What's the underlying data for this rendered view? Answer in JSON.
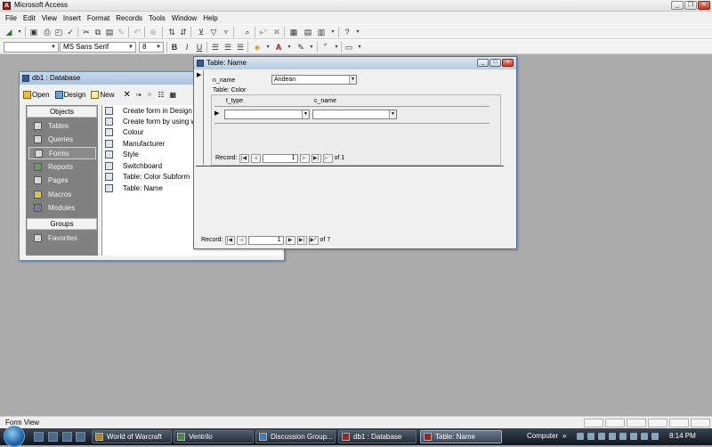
{
  "app": {
    "title": "Microsoft Access"
  },
  "menu": [
    "File",
    "Edit",
    "View",
    "Insert",
    "Format",
    "Records",
    "Tools",
    "Window",
    "Help"
  ],
  "format_toolbar": {
    "font": "MS Sans Serif",
    "size": "8",
    "bold": "B",
    "italic": "I",
    "underline": "U"
  },
  "db_window": {
    "title": "db1 : Database",
    "toolbar": {
      "open": "Open",
      "design": "Design",
      "new": "New"
    },
    "objects_header": "Objects",
    "objects": [
      "Tables",
      "Queries",
      "Forms",
      "Reports",
      "Pages",
      "Macros",
      "Modules"
    ],
    "selected_object": "Forms",
    "groups_header": "Groups",
    "groups": [
      "Favorites"
    ],
    "list": [
      "Create form in Design view",
      "Create form by using wizard",
      "Colour",
      "Manufacturer",
      "Style",
      "Switchboard",
      "Table: Color Subform",
      "Table: Name"
    ]
  },
  "form_window": {
    "title": "Table: Name",
    "field_label": "n_name",
    "field_value": "Andean",
    "subform_label": "Table: Color",
    "subform_columns": [
      "t_type",
      "c_name"
    ],
    "subform_nav": {
      "record_label": "Record:",
      "current": "1",
      "of_label": "of",
      "total": "1"
    },
    "main_nav": {
      "record_label": "Record:",
      "current": "1",
      "of_label": "of",
      "total": "7"
    }
  },
  "statusbar": {
    "text": "Form View"
  },
  "taskbar": {
    "buttons": [
      "World of Warcraft",
      "Ventrilo",
      "Discussion Group...",
      "db1 : Database",
      "Table: Name"
    ],
    "active": "Table: Name",
    "computer_label": "Computer",
    "clock": "8:14 PM"
  }
}
